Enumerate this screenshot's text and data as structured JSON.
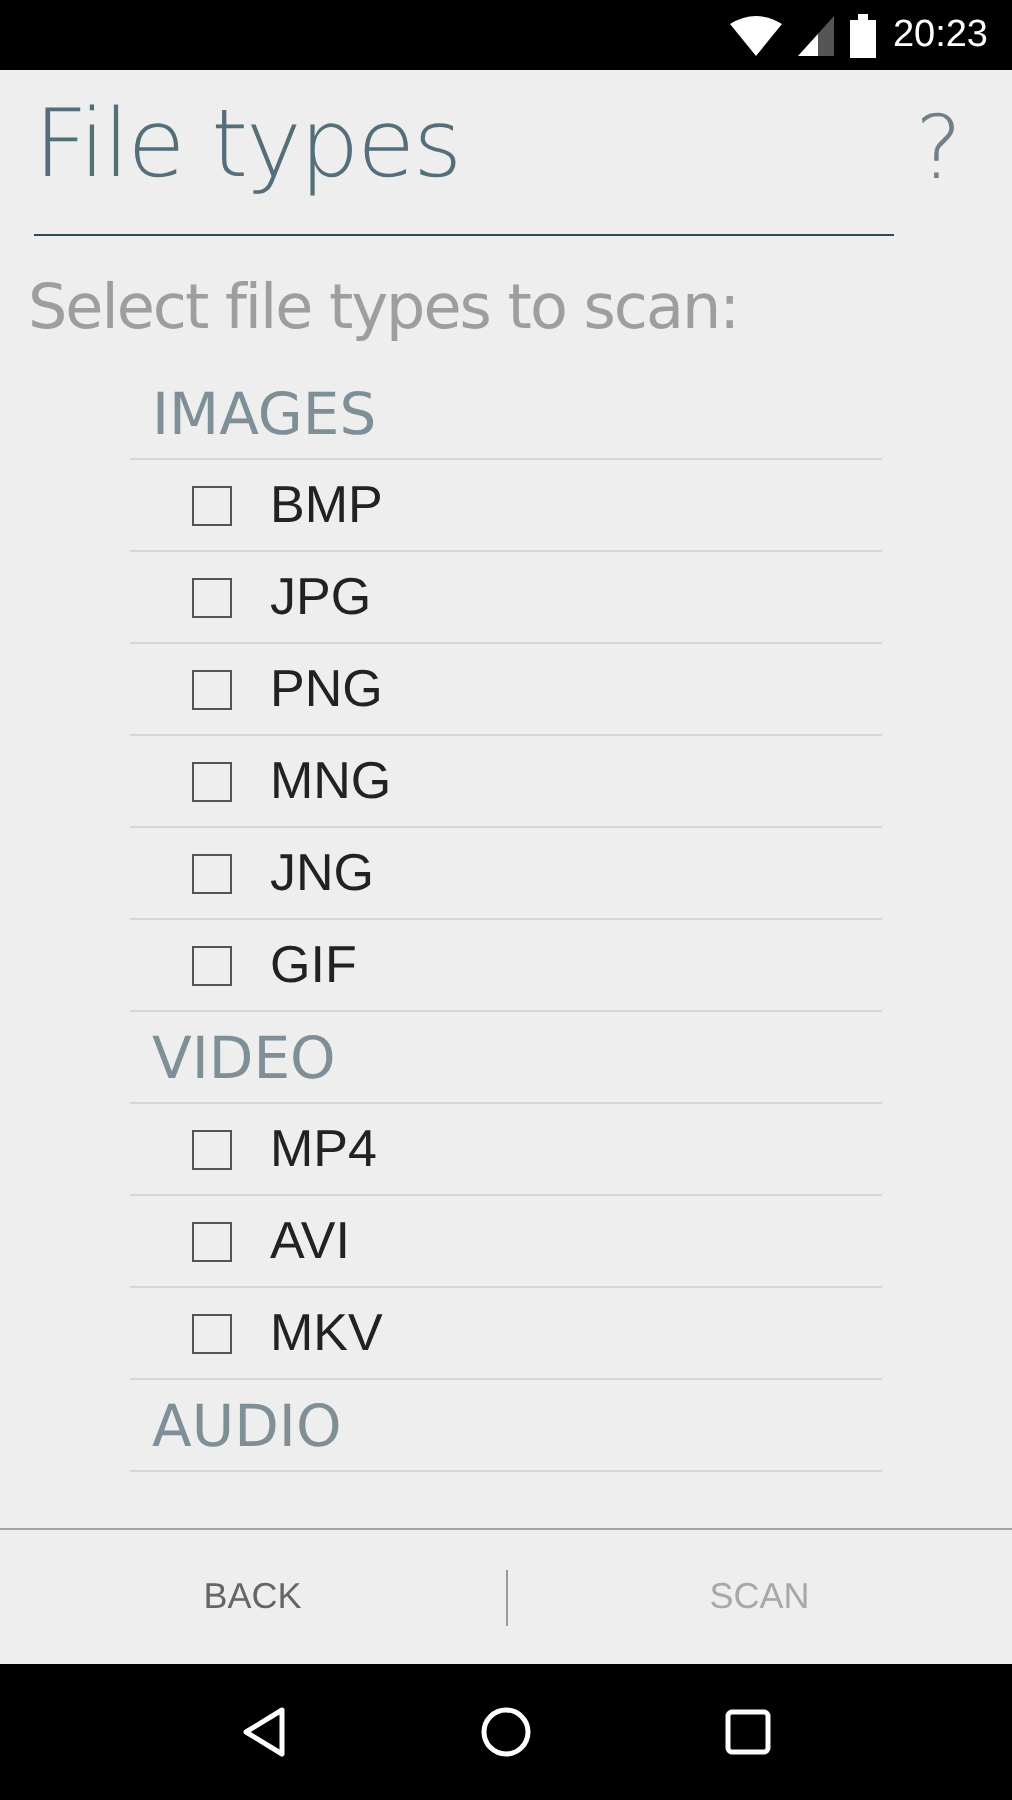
{
  "status_bar": {
    "time": "20:23"
  },
  "header": {
    "title": "File types",
    "help": "?"
  },
  "prompt": "Select file types to scan:",
  "sections": [
    {
      "label": "IMAGES",
      "items": [
        {
          "label": "BMP",
          "checked": false
        },
        {
          "label": "JPG",
          "checked": false
        },
        {
          "label": "PNG",
          "checked": false
        },
        {
          "label": "MNG",
          "checked": false
        },
        {
          "label": "JNG",
          "checked": false
        },
        {
          "label": "GIF",
          "checked": false
        }
      ]
    },
    {
      "label": "VIDEO",
      "items": [
        {
          "label": "MP4",
          "checked": false
        },
        {
          "label": "AVI",
          "checked": false
        },
        {
          "label": "MKV",
          "checked": false
        }
      ]
    },
    {
      "label": "AUDIO"
    }
  ],
  "buttons": [
    {
      "label": "BACK",
      "disabled": false
    },
    {
      "label": "SCAN",
      "disabled": true
    }
  ]
}
